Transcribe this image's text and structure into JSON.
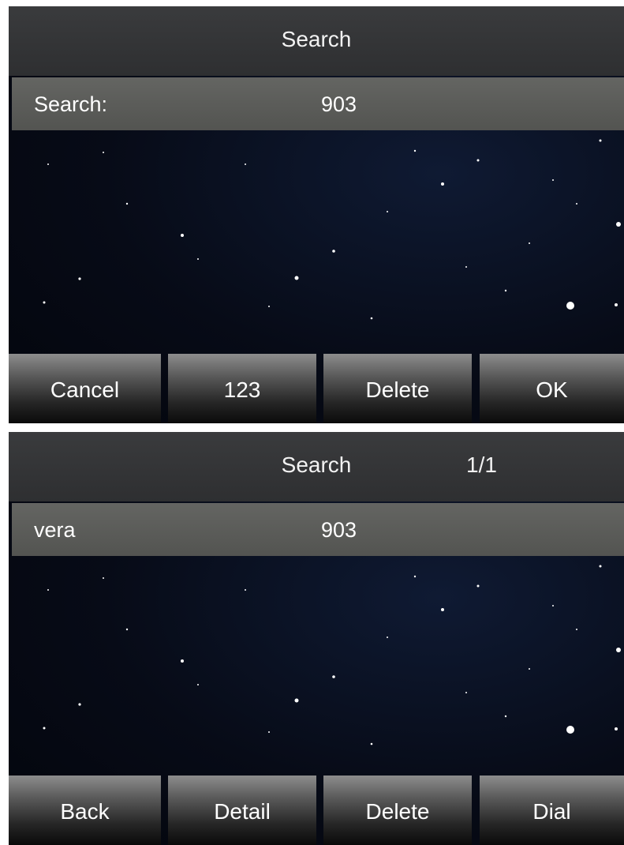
{
  "screens": [
    {
      "title": "Search",
      "page_indicator": "",
      "row": {
        "label": "Search:",
        "value": "903"
      },
      "softkeys": [
        "Cancel",
        "123",
        "Delete",
        "OK"
      ]
    },
    {
      "title": "Search",
      "page_indicator": "1/1",
      "row": {
        "label": "vera",
        "value": "903"
      },
      "softkeys": [
        "Back",
        "Detail",
        "Delete",
        "Dial"
      ]
    }
  ],
  "colors": {
    "title_bar": "#343537",
    "row_background": "#5c5d5a",
    "softkey_top": "#8d8d8d",
    "softkey_bottom": "#0a0a0a",
    "background": "#070b17"
  }
}
